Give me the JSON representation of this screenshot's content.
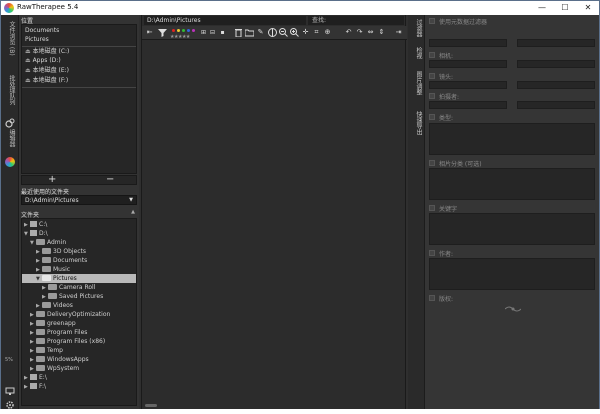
{
  "window": {
    "title": "RawTherapee 5.4",
    "controls": [
      "—",
      "☐",
      "✕"
    ]
  },
  "left_strip": {
    "tabs": [
      {
        "label": "文件浏览 (B)"
      },
      {
        "label": "批处理队列"
      },
      {
        "label": "编辑器"
      }
    ],
    "zoom": "5%"
  },
  "places": {
    "title": "位置",
    "items": [
      {
        "label": "Documents"
      },
      {
        "label": "Pictures"
      },
      {
        "label": "本地磁盘 (C:)"
      },
      {
        "label": "Apps (D:)"
      },
      {
        "label": "本地磁盘 (E:)"
      },
      {
        "label": "本地磁盘 (F:)"
      }
    ],
    "add_label": "+",
    "remove_label": "−"
  },
  "recent": {
    "title": "最近使用的文件夹",
    "value": "D:\\Admin\\Pictures"
  },
  "folders": {
    "title": "文件夹",
    "rows": [
      {
        "label": "C:\\"
      },
      {
        "label": "D:\\"
      },
      {
        "label": "Admin"
      },
      {
        "label": "3D Objects"
      },
      {
        "label": "Documents"
      },
      {
        "label": "Music"
      },
      {
        "label": "Pictures"
      },
      {
        "label": "Camera Roll"
      },
      {
        "label": "Saved Pictures"
      },
      {
        "label": "Videos"
      },
      {
        "label": "DeliveryOptimization"
      },
      {
        "label": "greenapp"
      },
      {
        "label": "Program Files"
      },
      {
        "label": "Program Files (x86)"
      },
      {
        "label": "Temp"
      },
      {
        "label": "WindowsApps"
      },
      {
        "label": "WpSystem"
      },
      {
        "label": "E:\\"
      },
      {
        "label": "F:\\"
      }
    ]
  },
  "viewer": {
    "path": "D:\\Admin\\Pictures",
    "search_label": "查找:"
  },
  "right_tabs": [
    {
      "label": "过滤器"
    },
    {
      "label": "检视"
    },
    {
      "label": "图片调整"
    },
    {
      "label": "快速导出"
    }
  ],
  "filters": {
    "exif_label": "使用元数据过滤器",
    "labels": [
      "相机:",
      "镜头:",
      "拍摄者:",
      "类型:"
    ],
    "title_label": "相片分类 (可选)",
    "keywords_label": "关键字",
    "artist_label": "作者:",
    "copyright_label": "版权:"
  }
}
